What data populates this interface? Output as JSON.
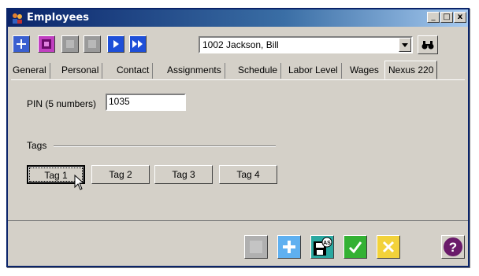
{
  "window": {
    "title": "Employees",
    "minimize_glyph": "_",
    "maximize_glyph": "□",
    "close_glyph": "x"
  },
  "toolbar": {
    "icons": [
      "add-record-icon",
      "save-record-icon",
      "first-record-icon",
      "previous-record-icon",
      "next-record-icon",
      "last-record-icon",
      "find-binoculars-icon"
    ],
    "employee_selector": {
      "value": "1002 Jackson, Bill"
    }
  },
  "tabs": [
    {
      "label": "General"
    },
    {
      "label": "Personal"
    },
    {
      "label": "Contact"
    },
    {
      "label": "Assignments"
    },
    {
      "label": "Schedule"
    },
    {
      "label": "Labor Level"
    },
    {
      "label": "Wages"
    },
    {
      "label": "Nexus 220",
      "active": true
    }
  ],
  "form": {
    "pin_label": "PIN (5 numbers)",
    "pin_value": "1035",
    "tags_group_label": "Tags",
    "tag_buttons": [
      "Tag 1",
      "Tag 2",
      "Tag 3",
      "Tag 4"
    ]
  },
  "bottom_bar": {
    "icons": [
      "disabled-icon",
      "add-icon",
      "save-as-icon",
      "confirm-check-icon",
      "cancel-x-icon",
      "help-question-icon"
    ],
    "save_as_badge": "AS",
    "help_glyph": "?"
  },
  "colors": {
    "title_bar": "#0a246a",
    "face": "#d4d0c8",
    "nav_blue": "#1e4fd8",
    "save_purple": "#c040c0",
    "check_green": "#33b133",
    "cancel_yellow": "#f2d23a",
    "help_purple": "#6a1a6a"
  }
}
